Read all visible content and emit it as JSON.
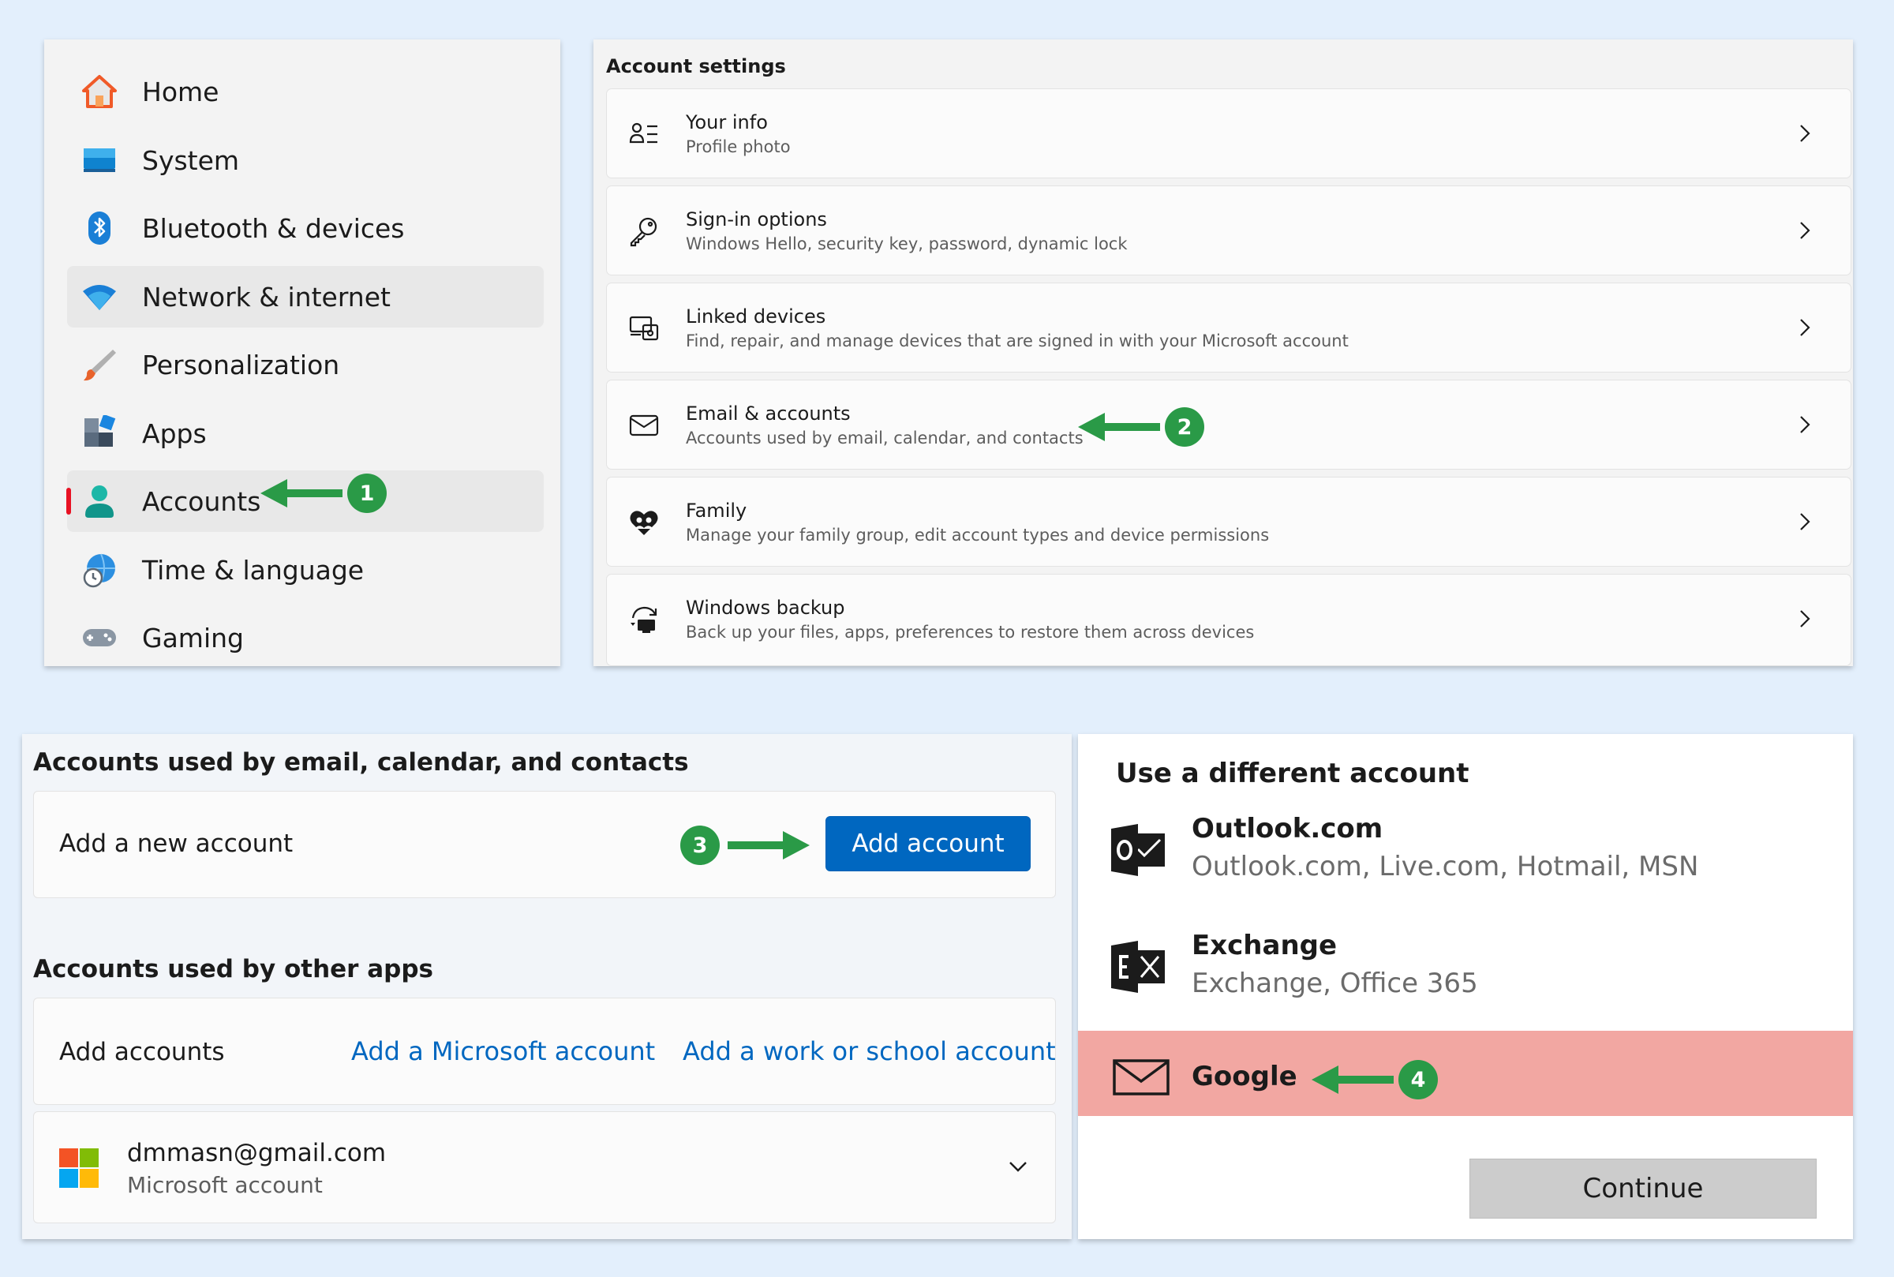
{
  "nav": {
    "items": [
      {
        "label": "Home",
        "icon": "home-icon"
      },
      {
        "label": "System",
        "icon": "system-icon"
      },
      {
        "label": "Bluetooth & devices",
        "icon": "bluetooth-icon"
      },
      {
        "label": "Network & internet",
        "icon": "wifi-icon"
      },
      {
        "label": "Personalization",
        "icon": "brush-icon"
      },
      {
        "label": "Apps",
        "icon": "apps-icon"
      },
      {
        "label": "Accounts",
        "icon": "accounts-icon"
      },
      {
        "label": "Time & language",
        "icon": "globe-clock-icon"
      },
      {
        "label": "Gaming",
        "icon": "gamepad-icon"
      }
    ],
    "selected": "Accounts"
  },
  "account_settings": {
    "header": "Account settings",
    "rows": [
      {
        "title": "Your info",
        "subtitle": "Profile photo",
        "icon": "person-list-icon"
      },
      {
        "title": "Sign-in options",
        "subtitle": "Windows Hello, security key, password, dynamic lock",
        "icon": "key-icon"
      },
      {
        "title": "Linked devices",
        "subtitle": "Find, repair, and manage devices that are signed in with your Microsoft account",
        "icon": "linked-devices-icon"
      },
      {
        "title": "Email & accounts",
        "subtitle": "Accounts used by email, calendar, and contacts",
        "icon": "mail-icon"
      },
      {
        "title": "Family",
        "subtitle": "Manage your family group, edit account types and device permissions",
        "icon": "family-heart-icon"
      },
      {
        "title": "Windows backup",
        "subtitle": "Back up your files, apps, preferences to restore them across devices",
        "icon": "backup-icon"
      }
    ]
  },
  "email_accounts": {
    "header": "Accounts used by email, calendar, and contacts",
    "add_new_label": "Add a new account",
    "add_button": "Add account",
    "other_header": "Accounts used by other apps",
    "add_accounts_label": "Add accounts",
    "add_microsoft_link": "Add a Microsoft account",
    "add_work_link": "Add a work or school account",
    "existing": {
      "email": "dmmasn@gmail.com",
      "type": "Microsoft account"
    }
  },
  "different_account": {
    "header": "Use a different account",
    "options": [
      {
        "name": "Outlook.com",
        "sub": "Outlook.com, Live.com, Hotmail, MSN"
      },
      {
        "name": "Exchange",
        "sub": "Exchange, Office 365"
      },
      {
        "name": "Google",
        "sub": ""
      }
    ],
    "continue_button": "Continue"
  },
  "steps": [
    "1",
    "2",
    "3",
    "4"
  ],
  "colors": {
    "accent": "#0067c0",
    "step_green": "#2a9a47",
    "google_highlight": "#f2a7a2",
    "selected_indicator": "#e81123",
    "background": "#e3effc"
  }
}
